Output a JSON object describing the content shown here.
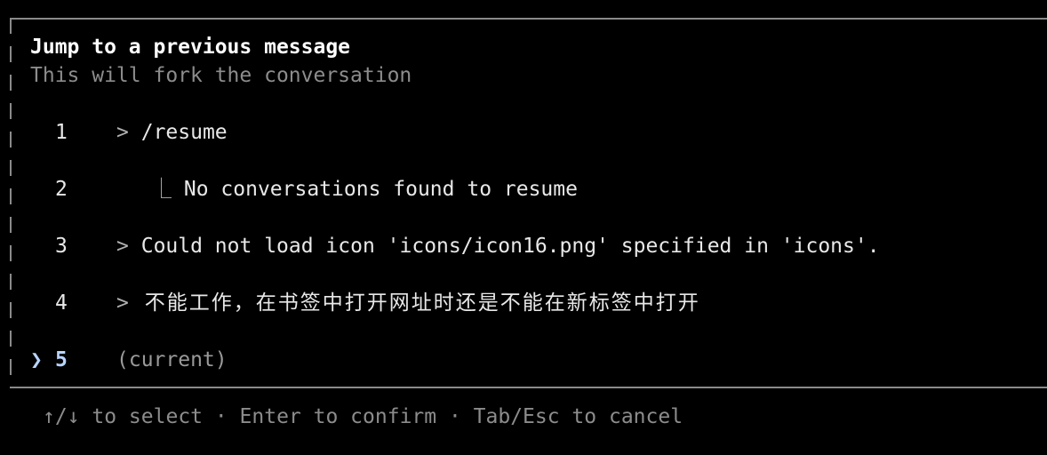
{
  "header": {
    "title": "Jump to a previous message",
    "subtitle": "This will fork the conversation"
  },
  "messages": [
    {
      "num": "1",
      "prefix": ">",
      "text": "/resume"
    },
    {
      "num": "2",
      "prefix": "⎿",
      "text": "No conversations found to resume"
    },
    {
      "num": "3",
      "prefix": ">",
      "text": "Could not load icon 'icons/icon16.png' specified in 'icons'."
    },
    {
      "num": "4",
      "prefix": ">",
      "text": "不能工作，在书签中打开网址时还是不能在新标签中打开"
    },
    {
      "num": "5",
      "prefix": "",
      "text": "(current)"
    }
  ],
  "selected_marker": "❯",
  "footer": {
    "hint": "↑/↓ to select · Enter to confirm · Tab/Esc to cancel"
  }
}
